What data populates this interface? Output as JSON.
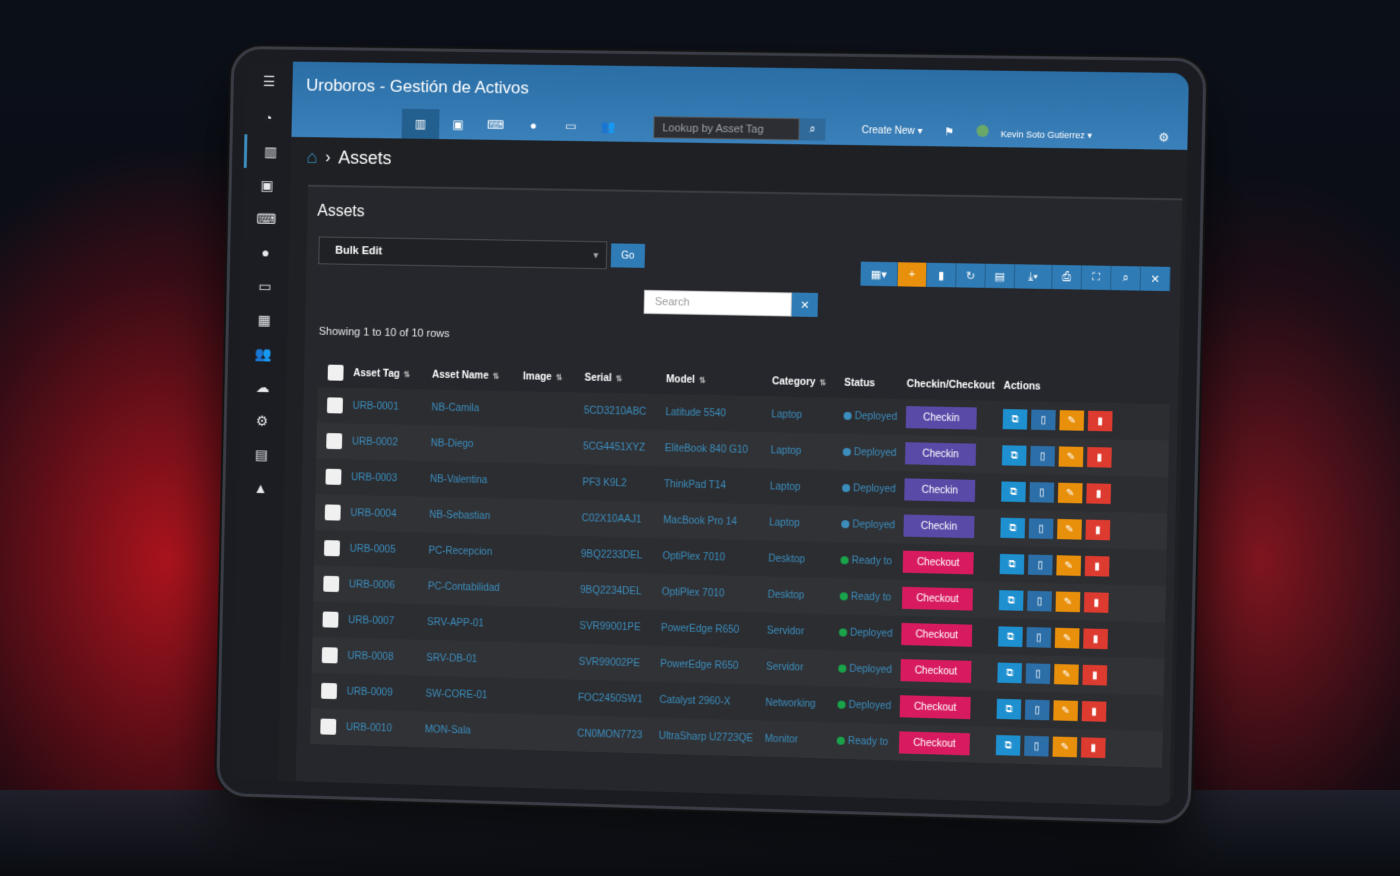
{
  "app": {
    "title": "Uroboros - Gestión de Activos"
  },
  "header": {
    "lookup_placeholder": "Lookup by Asset Tag",
    "create_new": "Create New",
    "user_name": "Kevin Soto Gutierrez"
  },
  "breadcrumb": {
    "title": "Assets"
  },
  "box": {
    "title": "Assets",
    "bulk_action": "Bulk Edit",
    "go_label": "Go",
    "search_placeholder": "Search",
    "showing": "Showing 1 to 10 of 10 rows"
  },
  "table": {
    "columns": [
      "Asset Tag",
      "Asset Name",
      "Image",
      "Serial",
      "Model",
      "Category",
      "Status",
      "Checkin/Checkout",
      "Actions"
    ],
    "rows": [
      {
        "tag": "URB-0001",
        "name": "NB-Camila",
        "serial": "5CD3210ABC",
        "model": "Latitude 5540",
        "category": "Laptop",
        "status": "Deployed",
        "status_color": "blue",
        "cc": "Checkin"
      },
      {
        "tag": "URB-0002",
        "name": "NB-Diego",
        "serial": "5CG4451XYZ",
        "model": "EliteBook 840 G10",
        "category": "Laptop",
        "status": "Deployed",
        "status_color": "blue",
        "cc": "Checkin"
      },
      {
        "tag": "URB-0003",
        "name": "NB-Valentina",
        "serial": "PF3 K9L2",
        "model": "ThinkPad T14",
        "category": "Laptop",
        "status": "Deployed",
        "status_color": "blue",
        "cc": "Checkin"
      },
      {
        "tag": "URB-0004",
        "name": "NB-Sebastian",
        "serial": "C02X10AAJ1",
        "model": "MacBook Pro 14",
        "category": "Laptop",
        "status": "Deployed",
        "status_color": "blue",
        "cc": "Checkin"
      },
      {
        "tag": "URB-0005",
        "name": "PC-Recepcion",
        "serial": "9BQ2233DEL",
        "model": "OptiPlex 7010",
        "category": "Desktop",
        "status": "Ready to",
        "status_color": "green",
        "cc": "Checkout"
      },
      {
        "tag": "URB-0006",
        "name": "PC-Contabilidad",
        "serial": "9BQ2234DEL",
        "model": "OptiPlex 7010",
        "category": "Desktop",
        "status": "Ready to",
        "status_color": "green",
        "cc": "Checkout"
      },
      {
        "tag": "URB-0007",
        "name": "SRV-APP-01",
        "serial": "SVR99001PE",
        "model": "PowerEdge R650",
        "category": "Servidor",
        "status": "Deployed",
        "status_color": "green",
        "cc": "Checkout"
      },
      {
        "tag": "URB-0008",
        "name": "SRV-DB-01",
        "serial": "SVR99002PE",
        "model": "PowerEdge R650",
        "category": "Servidor",
        "status": "Deployed",
        "status_color": "green",
        "cc": "Checkout"
      },
      {
        "tag": "URB-0009",
        "name": "SW-CORE-01",
        "serial": "FOC2450SW1",
        "model": "Catalyst 2960-X",
        "category": "Networking",
        "status": "Deployed",
        "status_color": "green",
        "cc": "Checkout"
      },
      {
        "tag": "URB-0010",
        "name": "MON-Sala",
        "serial": "CN0MON7723",
        "model": "UltraSharp U2723QE",
        "category": "Monitor",
        "status": "Ready to",
        "status_color": "green",
        "cc": "Checkout"
      }
    ]
  },
  "icons": {
    "sidebar": [
      "menu-icon",
      "dashboard-icon",
      "barcode-icon",
      "license-icon",
      "keyboard-icon",
      "drop-icon",
      "hdd-icon",
      "kit-icon",
      "users-icon",
      "cloud-upload-icon",
      "gear-icon",
      "chart-icon",
      "bell-icon"
    ],
    "toolbar": [
      "columns-icon",
      "plus-icon",
      "trash-icon",
      "refresh-icon",
      "export-icon",
      "download-icon",
      "print-icon",
      "fullscreen-icon",
      "search-icon",
      "tools-icon"
    ]
  }
}
